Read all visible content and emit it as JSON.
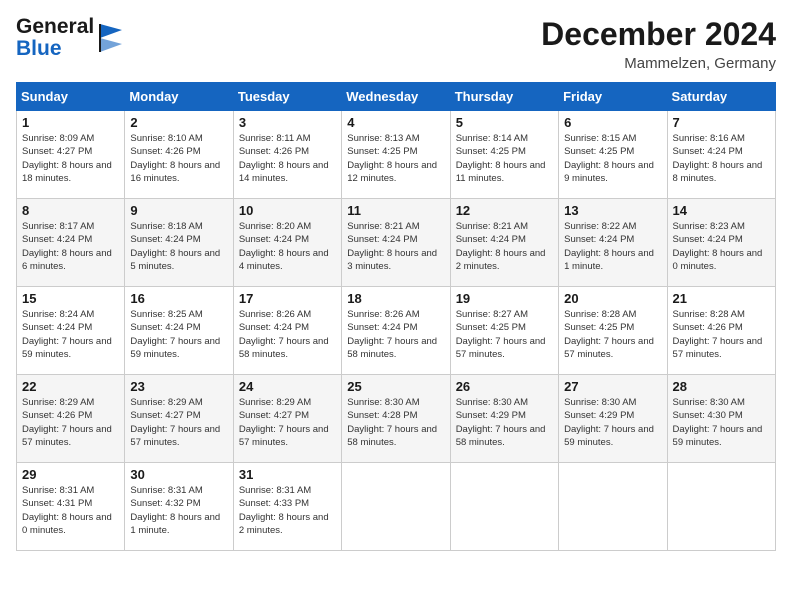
{
  "header": {
    "logo_line1": "General",
    "logo_line2": "Blue",
    "month": "December 2024",
    "location": "Mammelzen, Germany"
  },
  "weekdays": [
    "Sunday",
    "Monday",
    "Tuesday",
    "Wednesday",
    "Thursday",
    "Friday",
    "Saturday"
  ],
  "weeks": [
    [
      {
        "day": "1",
        "sunrise": "8:09 AM",
        "sunset": "4:27 PM",
        "daylight": "8 hours and 18 minutes."
      },
      {
        "day": "2",
        "sunrise": "8:10 AM",
        "sunset": "4:26 PM",
        "daylight": "8 hours and 16 minutes."
      },
      {
        "day": "3",
        "sunrise": "8:11 AM",
        "sunset": "4:26 PM",
        "daylight": "8 hours and 14 minutes."
      },
      {
        "day": "4",
        "sunrise": "8:13 AM",
        "sunset": "4:25 PM",
        "daylight": "8 hours and 12 minutes."
      },
      {
        "day": "5",
        "sunrise": "8:14 AM",
        "sunset": "4:25 PM",
        "daylight": "8 hours and 11 minutes."
      },
      {
        "day": "6",
        "sunrise": "8:15 AM",
        "sunset": "4:25 PM",
        "daylight": "8 hours and 9 minutes."
      },
      {
        "day": "7",
        "sunrise": "8:16 AM",
        "sunset": "4:24 PM",
        "daylight": "8 hours and 8 minutes."
      }
    ],
    [
      {
        "day": "8",
        "sunrise": "8:17 AM",
        "sunset": "4:24 PM",
        "daylight": "8 hours and 6 minutes."
      },
      {
        "day": "9",
        "sunrise": "8:18 AM",
        "sunset": "4:24 PM",
        "daylight": "8 hours and 5 minutes."
      },
      {
        "day": "10",
        "sunrise": "8:20 AM",
        "sunset": "4:24 PM",
        "daylight": "8 hours and 4 minutes."
      },
      {
        "day": "11",
        "sunrise": "8:21 AM",
        "sunset": "4:24 PM",
        "daylight": "8 hours and 3 minutes."
      },
      {
        "day": "12",
        "sunrise": "8:21 AM",
        "sunset": "4:24 PM",
        "daylight": "8 hours and 2 minutes."
      },
      {
        "day": "13",
        "sunrise": "8:22 AM",
        "sunset": "4:24 PM",
        "daylight": "8 hours and 1 minute."
      },
      {
        "day": "14",
        "sunrise": "8:23 AM",
        "sunset": "4:24 PM",
        "daylight": "8 hours and 0 minutes."
      }
    ],
    [
      {
        "day": "15",
        "sunrise": "8:24 AM",
        "sunset": "4:24 PM",
        "daylight": "7 hours and 59 minutes."
      },
      {
        "day": "16",
        "sunrise": "8:25 AM",
        "sunset": "4:24 PM",
        "daylight": "7 hours and 59 minutes."
      },
      {
        "day": "17",
        "sunrise": "8:26 AM",
        "sunset": "4:24 PM",
        "daylight": "7 hours and 58 minutes."
      },
      {
        "day": "18",
        "sunrise": "8:26 AM",
        "sunset": "4:24 PM",
        "daylight": "7 hours and 58 minutes."
      },
      {
        "day": "19",
        "sunrise": "8:27 AM",
        "sunset": "4:25 PM",
        "daylight": "7 hours and 57 minutes."
      },
      {
        "day": "20",
        "sunrise": "8:28 AM",
        "sunset": "4:25 PM",
        "daylight": "7 hours and 57 minutes."
      },
      {
        "day": "21",
        "sunrise": "8:28 AM",
        "sunset": "4:26 PM",
        "daylight": "7 hours and 57 minutes."
      }
    ],
    [
      {
        "day": "22",
        "sunrise": "8:29 AM",
        "sunset": "4:26 PM",
        "daylight": "7 hours and 57 minutes."
      },
      {
        "day": "23",
        "sunrise": "8:29 AM",
        "sunset": "4:27 PM",
        "daylight": "7 hours and 57 minutes."
      },
      {
        "day": "24",
        "sunrise": "8:29 AM",
        "sunset": "4:27 PM",
        "daylight": "7 hours and 57 minutes."
      },
      {
        "day": "25",
        "sunrise": "8:30 AM",
        "sunset": "4:28 PM",
        "daylight": "7 hours and 58 minutes."
      },
      {
        "day": "26",
        "sunrise": "8:30 AM",
        "sunset": "4:29 PM",
        "daylight": "7 hours and 58 minutes."
      },
      {
        "day": "27",
        "sunrise": "8:30 AM",
        "sunset": "4:29 PM",
        "daylight": "7 hours and 59 minutes."
      },
      {
        "day": "28",
        "sunrise": "8:30 AM",
        "sunset": "4:30 PM",
        "daylight": "7 hours and 59 minutes."
      }
    ],
    [
      {
        "day": "29",
        "sunrise": "8:31 AM",
        "sunset": "4:31 PM",
        "daylight": "8 hours and 0 minutes."
      },
      {
        "day": "30",
        "sunrise": "8:31 AM",
        "sunset": "4:32 PM",
        "daylight": "8 hours and 1 minute."
      },
      {
        "day": "31",
        "sunrise": "8:31 AM",
        "sunset": "4:33 PM",
        "daylight": "8 hours and 2 minutes."
      },
      null,
      null,
      null,
      null
    ]
  ]
}
